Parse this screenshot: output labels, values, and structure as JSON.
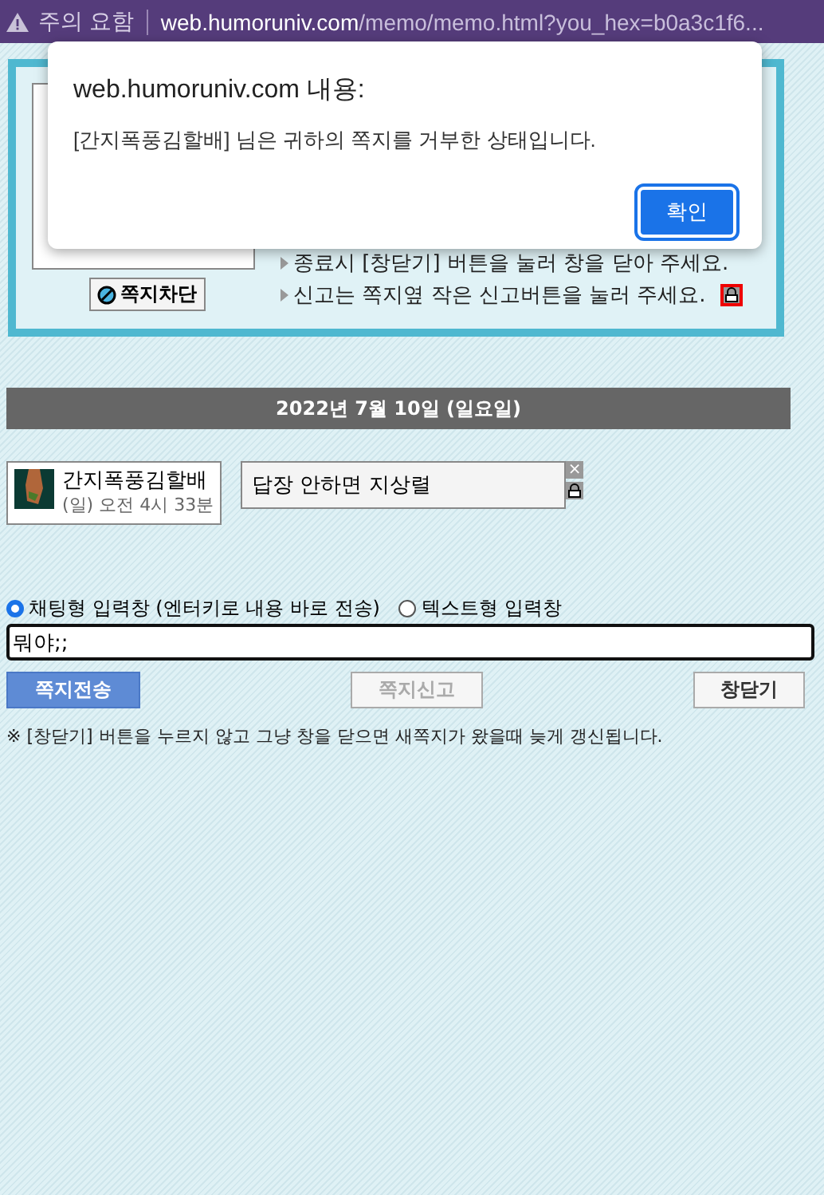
{
  "address_bar": {
    "warning": "주의 요함",
    "url_host": "web.humoruniv.com",
    "url_path": "/memo/memo.html?you_hex=b0a3c1f6..."
  },
  "profile_panel": {
    "block_button": "쪽지차단",
    "notes": [
      "종료시 [창닫기] 버튼을 눌러 창을 닫아 주세요.",
      "신고는 쪽지옆 작은 신고버튼을 눌러 주세요."
    ]
  },
  "date_header": "2022년 7월 10일 (일요일)",
  "messages": [
    {
      "sender": "간지폭풍김할배",
      "time": "(일) 오전 4시 33분",
      "text": "답장 안하면 지상렬",
      "delete_icon": "×"
    }
  ],
  "input_modes": [
    {
      "label": "채팅형 입력창 (엔터키로 내용 바로 전송)",
      "selected": true
    },
    {
      "label": "텍스트형 입력창",
      "selected": false
    }
  ],
  "message_input": {
    "value": "뭐야;;"
  },
  "buttons": [
    {
      "label": "쪽지전송",
      "kind": "primary",
      "disabled": false
    },
    {
      "label": "쪽지신고",
      "kind": "plain",
      "disabled": true
    },
    {
      "label": "창닫기",
      "kind": "plain",
      "disabled": false
    }
  ],
  "footnote": "※ [창닫기] 버튼을 누르지 않고 그냥 창을 닫으면 새쪽지가 왔을때 늦게 갱신됩니다.",
  "dialog": {
    "title": "web.humoruniv.com 내용:",
    "message": "[간지폭풍김할배] 님은 귀하의 쪽지를 거부한 상태입니다.",
    "ok_button": "확인"
  }
}
